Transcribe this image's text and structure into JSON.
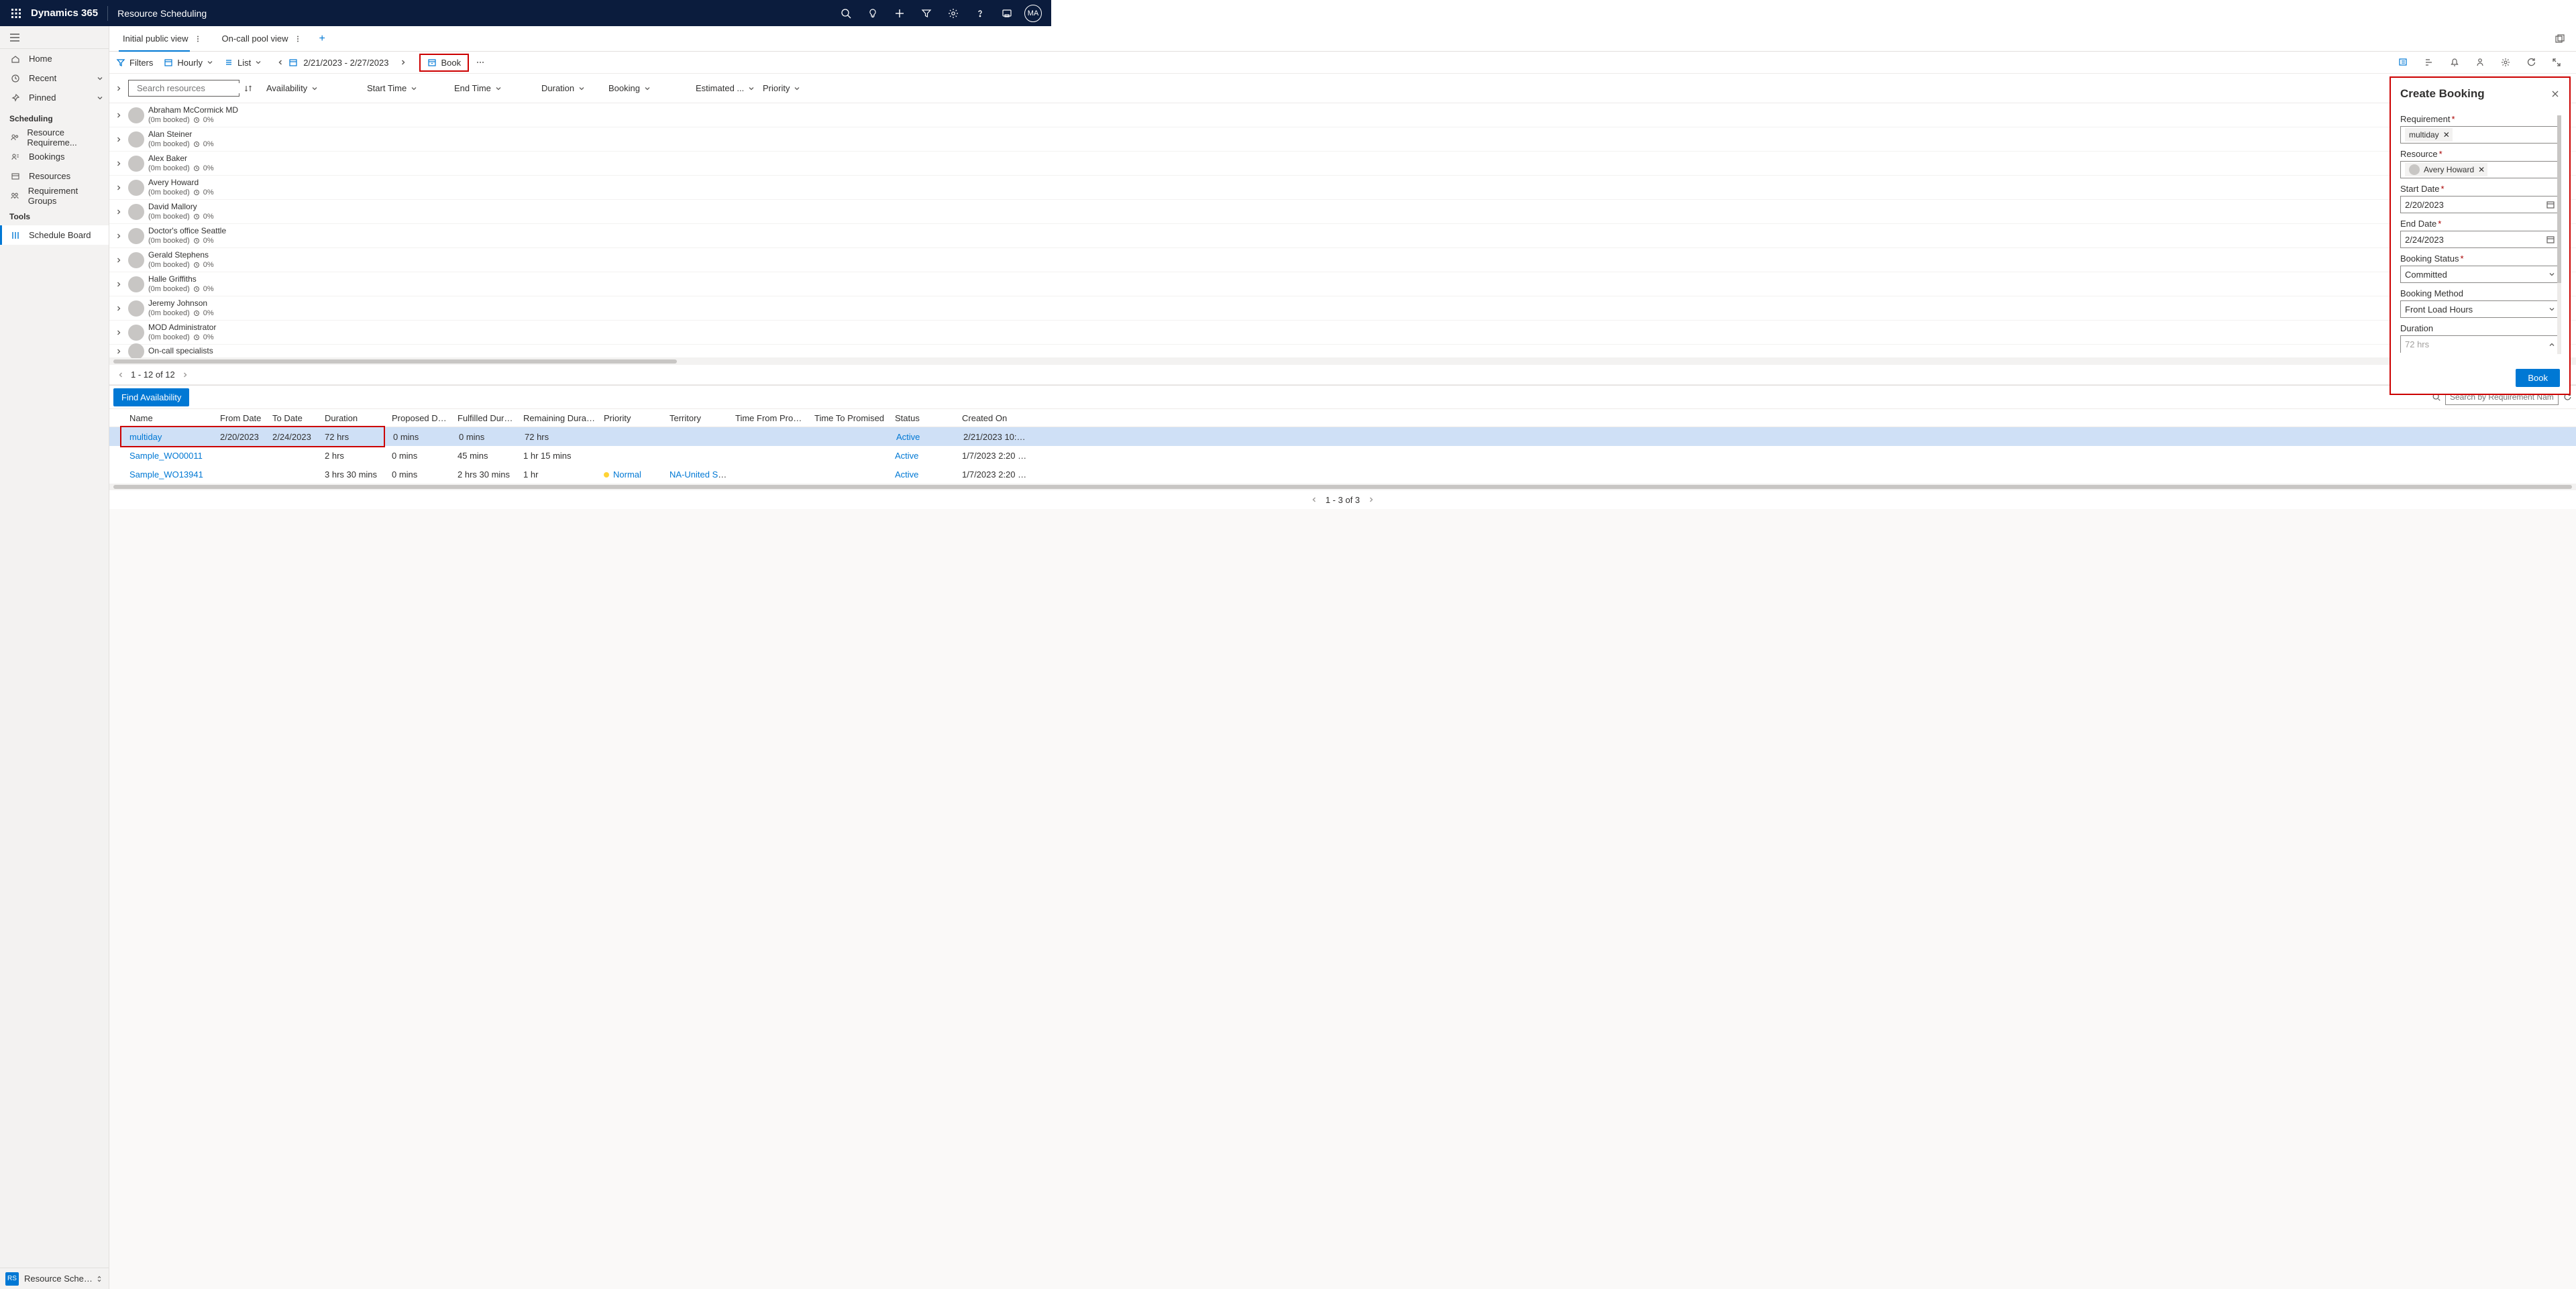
{
  "header": {
    "brand": "Dynamics 365",
    "module": "Resource Scheduling",
    "avatar_initials": "MA"
  },
  "sidebar": {
    "home": "Home",
    "recent": "Recent",
    "pinned": "Pinned",
    "section_scheduling": "Scheduling",
    "resource_req": "Resource Requireme...",
    "bookings": "Bookings",
    "resources": "Resources",
    "req_groups": "Requirement Groups",
    "section_tools": "Tools",
    "schedule_board": "Schedule Board",
    "switcher_badge": "RS",
    "switcher_label": "Resource Schedul..."
  },
  "tabs": {
    "tab1": "Initial public view",
    "tab2": "On-call pool view"
  },
  "toolbar": {
    "filters": "Filters",
    "hourly": "Hourly",
    "list": "List",
    "date_range": "2/21/2023 - 2/27/2023",
    "book": "Book"
  },
  "columns": {
    "search_placeholder": "Search resources",
    "availability": "Availability",
    "start_time": "Start Time",
    "end_time": "End Time",
    "duration": "Duration",
    "booking": "Booking",
    "estimated": "Estimated ...",
    "priority": "Priority"
  },
  "resources": [
    {
      "name": "Abraham McCormick MD",
      "sub1": "(0m booked)",
      "pct": "0%"
    },
    {
      "name": "Alan Steiner",
      "sub1": "(0m booked)",
      "pct": "0%"
    },
    {
      "name": "Alex Baker",
      "sub1": "(0m booked)",
      "pct": "0%"
    },
    {
      "name": "Avery Howard",
      "sub1": "(0m booked)",
      "pct": "0%"
    },
    {
      "name": "David Mallory",
      "sub1": "(0m booked)",
      "pct": "0%"
    },
    {
      "name": "Doctor's office Seattle",
      "sub1": "(0m booked)",
      "pct": "0%"
    },
    {
      "name": "Gerald Stephens",
      "sub1": "(0m booked)",
      "pct": "0%"
    },
    {
      "name": "Halle Griffiths",
      "sub1": "(0m booked)",
      "pct": "0%"
    },
    {
      "name": "Jeremy Johnson",
      "sub1": "(0m booked)",
      "pct": "0%"
    },
    {
      "name": "MOD Administrator",
      "sub1": "(0m booked)",
      "pct": "0%"
    },
    {
      "name": "On-call specialists",
      "sub1": "",
      "pct": ""
    }
  ],
  "pager": {
    "text": "1 - 12 of 12"
  },
  "panel": {
    "title": "Create Booking",
    "requirement_label": "Requirement",
    "requirement_value": "multiday",
    "resource_label": "Resource",
    "resource_value": "Avery Howard",
    "start_date_label": "Start Date",
    "start_date_value": "2/20/2023",
    "end_date_label": "End Date",
    "end_date_value": "2/24/2023",
    "booking_status_label": "Booking Status",
    "booking_status_value": "Committed",
    "booking_method_label": "Booking Method",
    "booking_method_value": "Front Load Hours",
    "duration_label": "Duration",
    "duration_value": "72 hrs",
    "book_button": "Book"
  },
  "bottom": {
    "find_availability": "Find Availability",
    "search_placeholder": "Search by Requirement Name",
    "cols": {
      "name": "Name",
      "from": "From Date",
      "to": "To Date",
      "duration": "Duration",
      "proposed": "Proposed Dur...",
      "fulfilled": "Fulfilled Durat...",
      "remaining": "Remaining Duration",
      "priority": "Priority",
      "territory": "Territory",
      "time_from": "Time From Promis...",
      "time_to": "Time To Promised",
      "status": "Status",
      "created": "Created On"
    },
    "rows": [
      {
        "name": "multiday",
        "from": "2/20/2023",
        "to": "2/24/2023",
        "duration": "72 hrs",
        "proposed": "0 mins",
        "fulfilled": "0 mins",
        "remaining": "72 hrs",
        "priority": "",
        "territory": "",
        "status": "Active",
        "created": "2/21/2023 10:01 A...",
        "selected": true
      },
      {
        "name": "Sample_WO00011",
        "from": "",
        "to": "",
        "duration": "2 hrs",
        "proposed": "0 mins",
        "fulfilled": "45 mins",
        "remaining": "1 hr 15 mins",
        "priority": "",
        "territory": "",
        "status": "Active",
        "created": "1/7/2023 2:20 PM"
      },
      {
        "name": "Sample_WO13941",
        "from": "",
        "to": "",
        "duration": "3 hrs 30 mins",
        "proposed": "0 mins",
        "fulfilled": "2 hrs 30 mins",
        "remaining": "1 hr",
        "priority": "Normal",
        "territory": "NA-United Sta...",
        "status": "Active",
        "created": "1/7/2023 2:20 PM"
      }
    ],
    "footer": "1 - 3 of 3"
  }
}
